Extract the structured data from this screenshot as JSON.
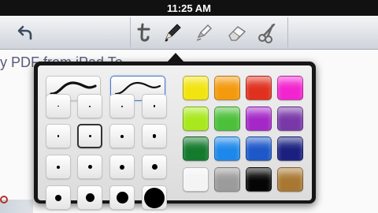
{
  "status_bar": {
    "time": "11:25 AM"
  },
  "toolbar": {
    "tools": [
      "undo",
      "text",
      "pen",
      "highlighter",
      "eraser",
      "scissors"
    ],
    "selected_tool": "pen"
  },
  "document": {
    "title_fragment": "y PDF from iPad To..."
  },
  "pen_popover": {
    "stroke_styles": [
      "thin-curve",
      "thick-curve"
    ],
    "selected_stroke_style": "thin-curve",
    "sizes": [
      "1",
      "2",
      "3",
      "4",
      "5",
      "6",
      "7",
      "8",
      "9",
      "10",
      "11",
      "12",
      "13",
      "14",
      "15",
      "16"
    ],
    "selected_size": "6",
    "colors": [
      "#f2e40f",
      "#f39a0e",
      "#e0301e",
      "#f224d0",
      "#a8e81c",
      "#4cc03a",
      "#a428c8",
      "#7838a8",
      "#147a2e",
      "#1d88ea",
      "#1d57c8",
      "#1b2080",
      "#f4f4f4",
      "#9b9b9b",
      "#050505",
      "#a87832"
    ]
  }
}
